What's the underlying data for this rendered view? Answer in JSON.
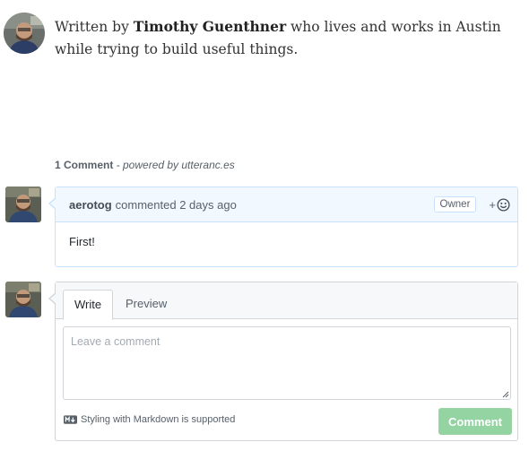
{
  "author": {
    "prefix": "Written by ",
    "name": "Timothy Guenthner",
    "suffix": " who lives and works in Austin while trying to build useful things."
  },
  "comments_section": {
    "count_label": "1 Comment",
    "powered_label": " - powered by utteranc.es"
  },
  "comment": {
    "login": "aerotog",
    "meta": "commented 2 days ago",
    "badge": "Owner",
    "reaction_plus": "+",
    "body": "First!"
  },
  "new_comment": {
    "tab_write": "Write",
    "tab_preview": "Preview",
    "placeholder": "Leave a comment",
    "markdown_hint": "Styling with Markdown is supported",
    "submit_label": "Comment"
  },
  "colors": {
    "header_bg": "#f1f8ff",
    "header_border": "#c8e1ff",
    "submit_bg": "#94d3a2"
  }
}
